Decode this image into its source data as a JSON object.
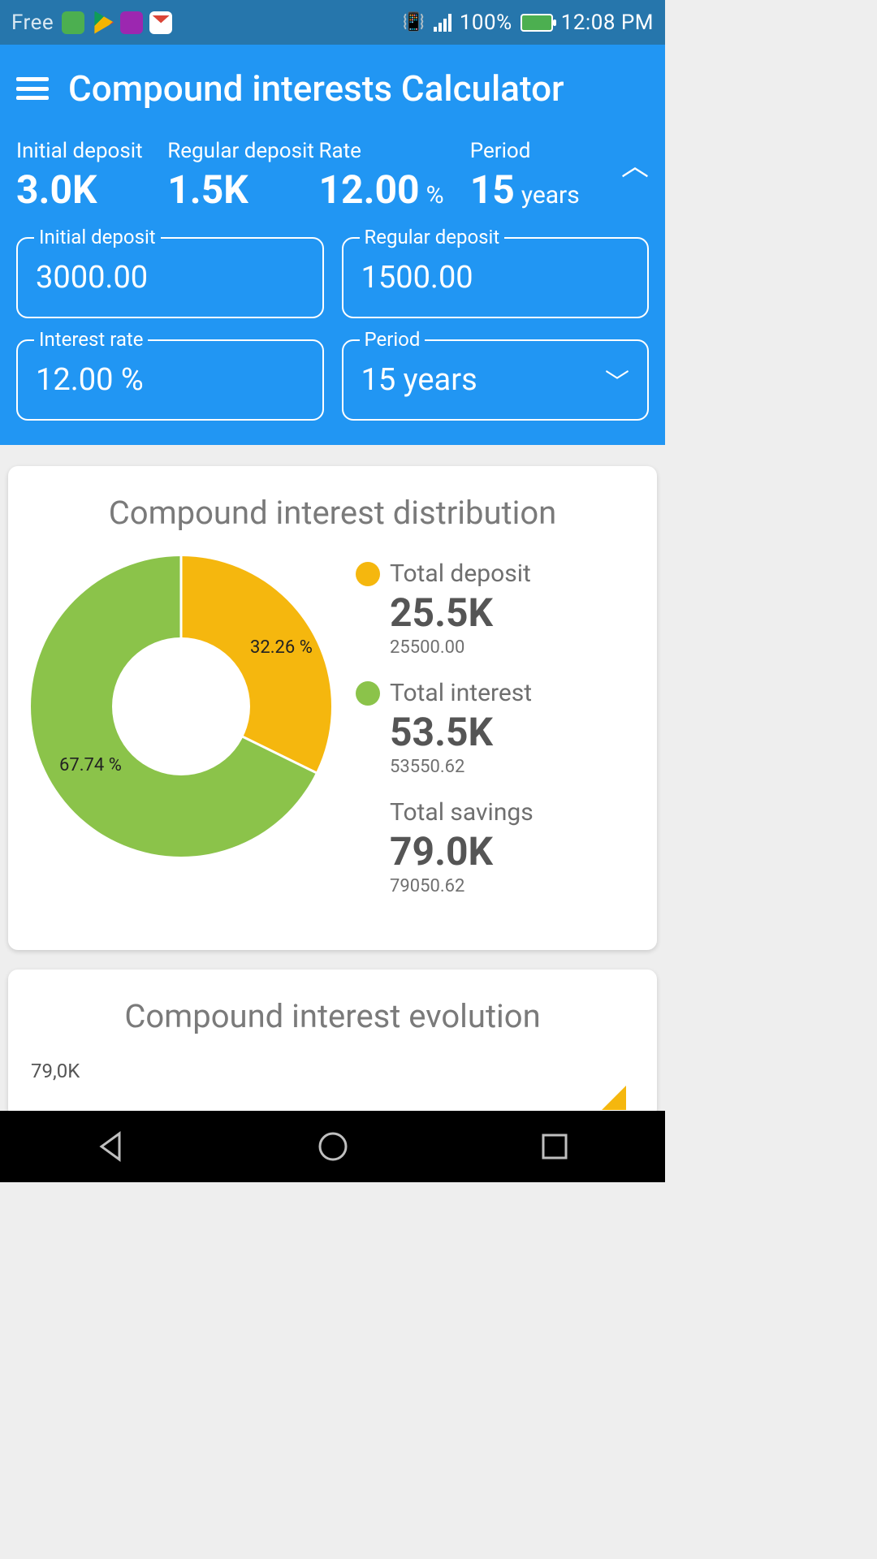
{
  "status": {
    "carrier": "Free",
    "battery_pct": "100%",
    "time": "12:08 PM"
  },
  "header": {
    "title": "Compound interests Calculator"
  },
  "summary": {
    "initial_deposit": {
      "label": "Initial deposit",
      "value": "3.0K"
    },
    "regular_deposit": {
      "label": "Regular deposit",
      "value": "1.5K"
    },
    "rate": {
      "label": "Rate",
      "value": "12.00",
      "unit": "%"
    },
    "period": {
      "label": "Period",
      "value": "15",
      "unit": "years"
    }
  },
  "inputs": {
    "initial_deposit": {
      "label": "Initial deposit",
      "value": "3000.00"
    },
    "regular_deposit": {
      "label": "Regular deposit",
      "value": "1500.00"
    },
    "interest_rate": {
      "label": "Interest rate",
      "value": "12.00 %"
    },
    "period": {
      "label": "Period",
      "value": "15 years"
    }
  },
  "distribution": {
    "title": "Compound interest distribution",
    "slice_deposit_pct": "32.26 %",
    "slice_interest_pct": "67.74 %",
    "legend": {
      "total_deposit": {
        "name": "Total deposit",
        "big": "25.5K",
        "small": "25500.00"
      },
      "total_interest": {
        "name": "Total interest",
        "big": "53.5K",
        "small": "53550.62"
      },
      "total_savings": {
        "name": "Total savings",
        "big": "79.0K",
        "small": "79050.62"
      }
    }
  },
  "evolution": {
    "title": "Compound interest evolution",
    "y_top_label": "79,0K"
  },
  "chart_data": {
    "type": "pie",
    "title": "Compound interest distribution",
    "series": [
      {
        "name": "Total deposit",
        "value": 25500.0,
        "percent": 32.26,
        "color": "#f5b70e"
      },
      {
        "name": "Total interest",
        "value": 53550.62,
        "percent": 67.74,
        "color": "#8bc34a"
      }
    ],
    "total": 79050.62
  }
}
